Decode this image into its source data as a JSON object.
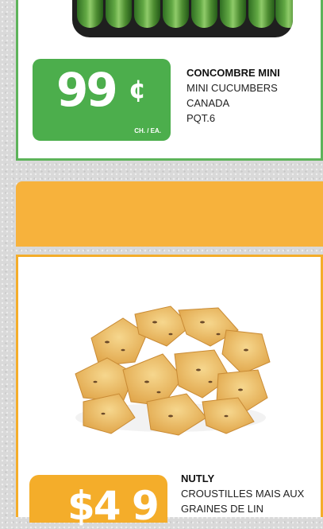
{
  "colors": {
    "green": "#4cae4c",
    "orange": "#f7b23c"
  },
  "product1": {
    "name": "CONCOMBRE MINI",
    "name_en": "MINI CUCUMBERS",
    "origin": "CANADA",
    "quantity": "PQT.6",
    "price_main": "99",
    "price_symbol": "¢",
    "unit": "CH. / EA."
  },
  "product2": {
    "name": "NUTLY",
    "desc_line1": "CROUSTILLES MAIS AUX",
    "desc_line2": "GRAINES DE LIN",
    "price_partial": "$4 9"
  }
}
